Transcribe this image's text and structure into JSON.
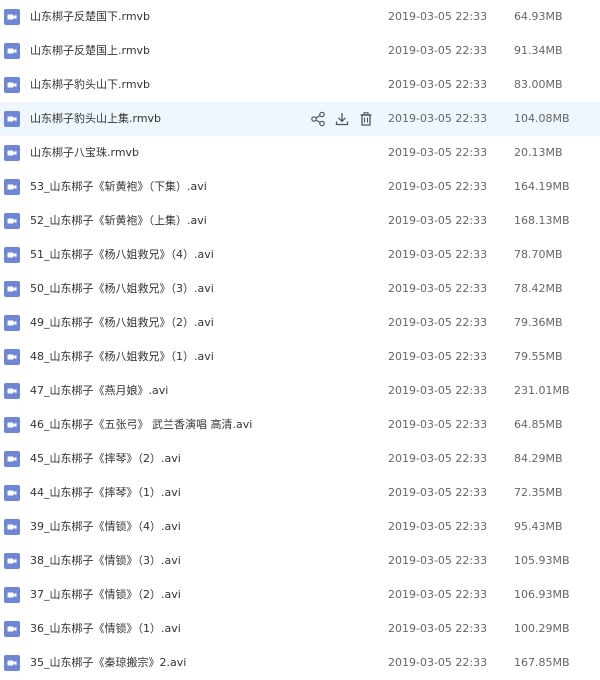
{
  "files": [
    {
      "name": "山东梆子反楚国下.rmvb",
      "date": "2019-03-05 22:33",
      "size": "64.93MB"
    },
    {
      "name": "山东梆子反楚国上.rmvb",
      "date": "2019-03-05 22:33",
      "size": "91.34MB"
    },
    {
      "name": "山东梆子豹头山下.rmvb",
      "date": "2019-03-05 22:33",
      "size": "83.00MB"
    },
    {
      "name": "山东梆子豹头山上集.rmvb",
      "date": "2019-03-05 22:33",
      "size": "104.08MB",
      "hovered": true
    },
    {
      "name": "山东梆子八宝珠.rmvb",
      "date": "2019-03-05 22:33",
      "size": "20.13MB"
    },
    {
      "name": "53_山东梆子《斩黄袍》（下集）.avi",
      "date": "2019-03-05 22:33",
      "size": "164.19MB"
    },
    {
      "name": "52_山东梆子《斩黄袍》（上集）.avi",
      "date": "2019-03-05 22:33",
      "size": "168.13MB"
    },
    {
      "name": "51_山东梆子《杨八姐救兄》（4）.avi",
      "date": "2019-03-05 22:33",
      "size": "78.70MB"
    },
    {
      "name": "50_山东梆子《杨八姐救兄》（3）.avi",
      "date": "2019-03-05 22:33",
      "size": "78.42MB"
    },
    {
      "name": "49_山东梆子《杨八姐救兄》（2）.avi",
      "date": "2019-03-05 22:33",
      "size": "79.36MB"
    },
    {
      "name": "48_山东梆子《杨八姐救兄》（1）.avi",
      "date": "2019-03-05 22:33",
      "size": "79.55MB"
    },
    {
      "name": "47_山东梆子《燕月娘》.avi",
      "date": "2019-03-05 22:33",
      "size": "231.01MB"
    },
    {
      "name": "46_山东梆子《五张弓》 武兰香演唱 高清.avi",
      "date": "2019-03-05 22:33",
      "size": "64.85MB"
    },
    {
      "name": "45_山东梆子《摔琴》（2）.avi",
      "date": "2019-03-05 22:33",
      "size": "84.29MB"
    },
    {
      "name": "44_山东梆子《摔琴》（1）.avi",
      "date": "2019-03-05 22:33",
      "size": "72.35MB"
    },
    {
      "name": "39_山东梆子《情锁》（4）.avi",
      "date": "2019-03-05 22:33",
      "size": "95.43MB"
    },
    {
      "name": "38_山东梆子《情锁》（3）.avi",
      "date": "2019-03-05 22:33",
      "size": "105.93MB"
    },
    {
      "name": "37_山东梆子《情锁》（2）.avi",
      "date": "2019-03-05 22:33",
      "size": "106.93MB"
    },
    {
      "name": "36_山东梆子《情锁》（1）.avi",
      "date": "2019-03-05 22:33",
      "size": "100.29MB"
    },
    {
      "name": "35_山东梆子《秦琼搬宗》2.avi",
      "date": "2019-03-05 22:33",
      "size": "167.85MB"
    }
  ],
  "row_actions": [
    {
      "icon": "share-icon"
    },
    {
      "icon": "download-icon"
    },
    {
      "icon": "delete-icon"
    }
  ],
  "colors": {
    "file_icon": "#6d86d6",
    "hover_row": "#eef7fe",
    "action_icon": "#555555"
  }
}
